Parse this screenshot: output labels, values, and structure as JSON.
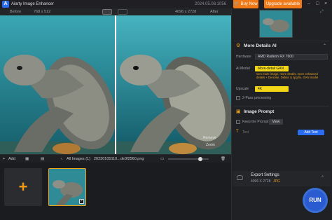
{
  "app": {
    "title": "Aiarty Image Enhancer",
    "version": "2024.05.08.1056",
    "buy_label": "Buy Now",
    "upgrade_label": "Upgrade available",
    "accent": "#f07a18",
    "win_controls": [
      "–",
      "□",
      "×"
    ]
  },
  "compare": {
    "before_label": "Before",
    "before_size": "768 x 512",
    "after_size": "4096 x 2728",
    "after_label": "After"
  },
  "preview": {
    "hint_lines": [
      "Remove",
      "Zoom"
    ]
  },
  "toolbar": {
    "add_label": "Add",
    "all_images_label": "All Images (1)",
    "filename": "20230105110...de3f2560.png"
  },
  "panel": {
    "more_details_title": "More Details AI",
    "hardware_label": "Hardware",
    "hardware_value": "AMD Radeon RX 7600",
    "ai_model_label": "AI Model",
    "ai_model_value": "More-detail GAN V2",
    "ai_model_desc": "Gen more image, more details, more enhanced details + Denoise, Deblur & Jpg fix, GAN model",
    "upscale_label": "Upscale",
    "upscale_value": "4K",
    "two_pass_label": "2-Pass processing",
    "image_prompt_title": "Image Prompt",
    "keep_prompt_label": "Keep the Prompt",
    "view_label": "View",
    "text_label": "Text",
    "add_text_label": "Add Text",
    "export_title": "Export Settings",
    "export_size": "4096 X 2728",
    "export_format": "JPG",
    "run_label": "RUN"
  }
}
